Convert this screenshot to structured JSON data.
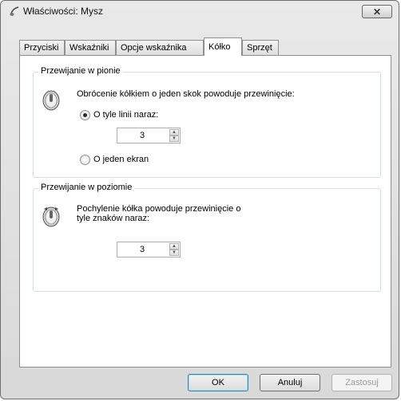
{
  "window": {
    "title": "Właściwości: Mysz"
  },
  "tabs": [
    {
      "label": "Przyciski"
    },
    {
      "label": "Wskaźniki"
    },
    {
      "label": "Opcje wskaźnika"
    },
    {
      "label": "Kółko"
    },
    {
      "label": "Sprzęt"
    }
  ],
  "vertical": {
    "title": "Przewijanie w pionie",
    "description": "Obrócenie kółkiem o jeden skok powoduje przewinięcie:",
    "option_lines_label": "O tyle linii naraz:",
    "lines_value": "3",
    "option_screen_label": "O jeden ekran"
  },
  "horizontal": {
    "title": "Przewijanie w poziomie",
    "description_line1": "Pochylenie kółka powoduje przewinięcie o",
    "description_line2": "tyle znaków naraz:",
    "chars_value": "3"
  },
  "buttons": {
    "ok": "OK",
    "cancel": "Anuluj",
    "apply": "Zastosuj"
  }
}
